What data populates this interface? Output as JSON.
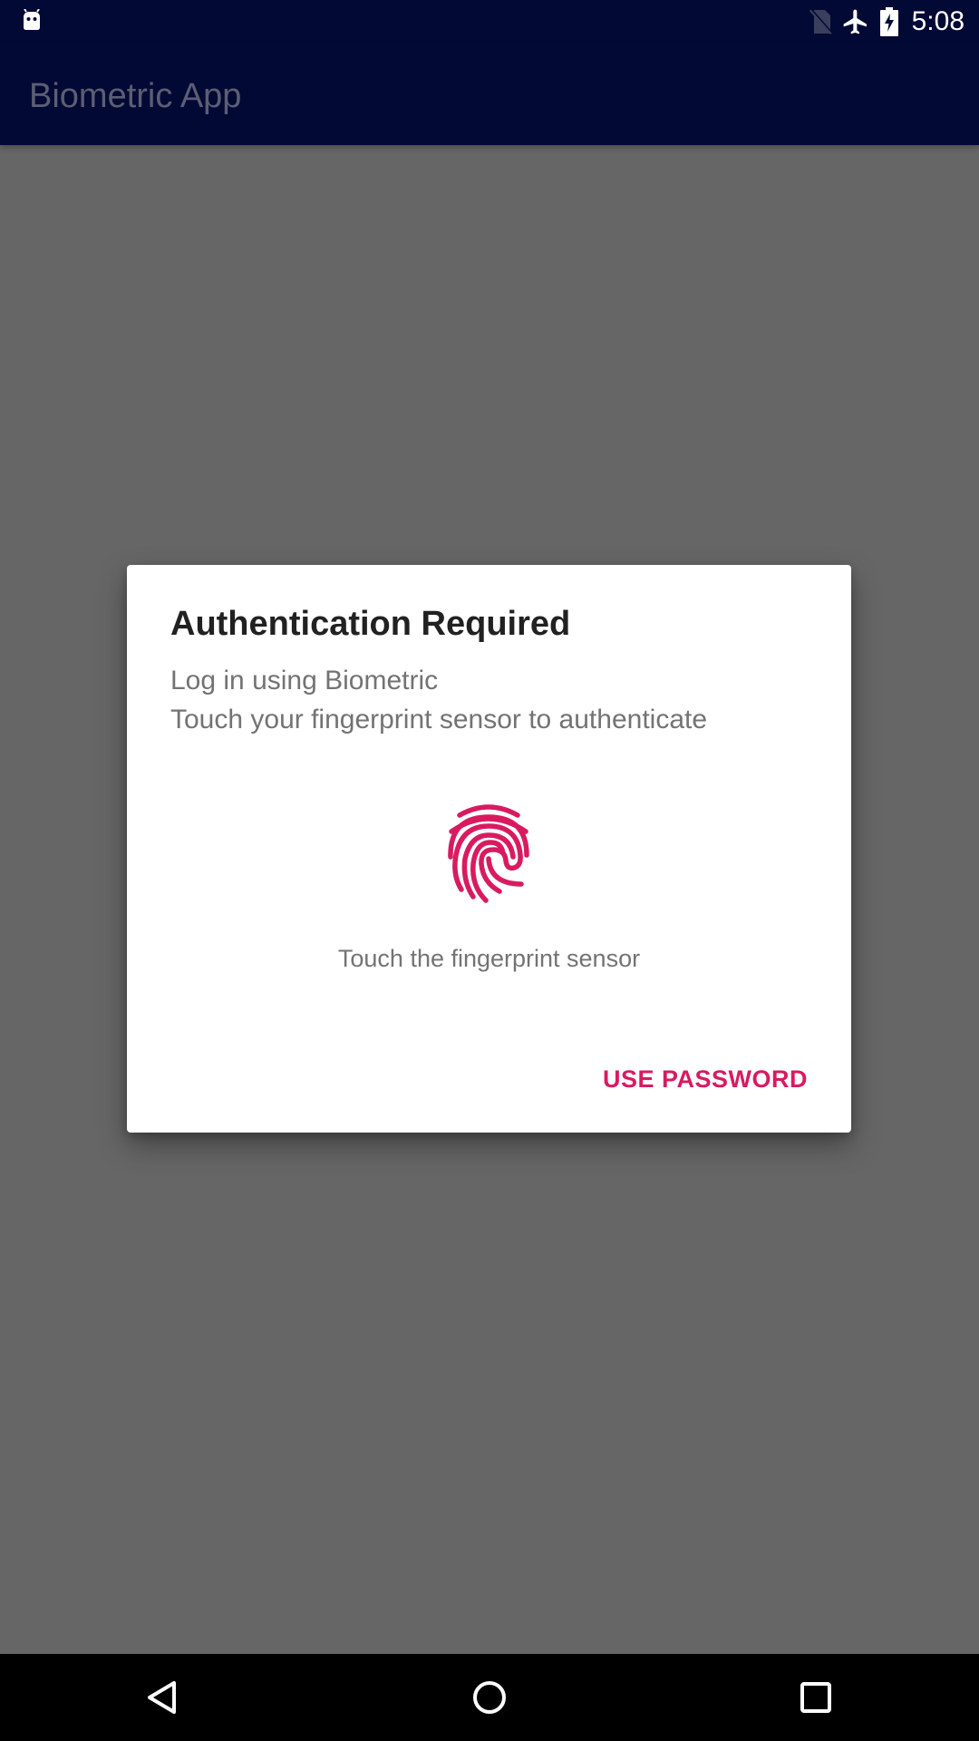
{
  "status_bar": {
    "time": "5:08",
    "icons": [
      "android-robot-icon",
      "no-sim-icon",
      "airplane-mode-icon",
      "battery-charging-icon"
    ]
  },
  "app_bar": {
    "title": "Biometric App"
  },
  "dialog": {
    "title": "Authentication Required",
    "subtitle": "Log in using Biometric",
    "description": "Touch your fingerprint sensor to authenticate",
    "icon": "fingerprint-icon",
    "status_text": "Touch the fingerprint sensor",
    "negative_button": "USE PASSWORD"
  },
  "nav_bar": {
    "icons": [
      "back-icon",
      "home-icon",
      "recents-icon"
    ]
  },
  "colors": {
    "status_bar": "#030935",
    "scrim_background": "#666666",
    "accent": "#d81b60",
    "dialog_background": "#ffffff"
  }
}
